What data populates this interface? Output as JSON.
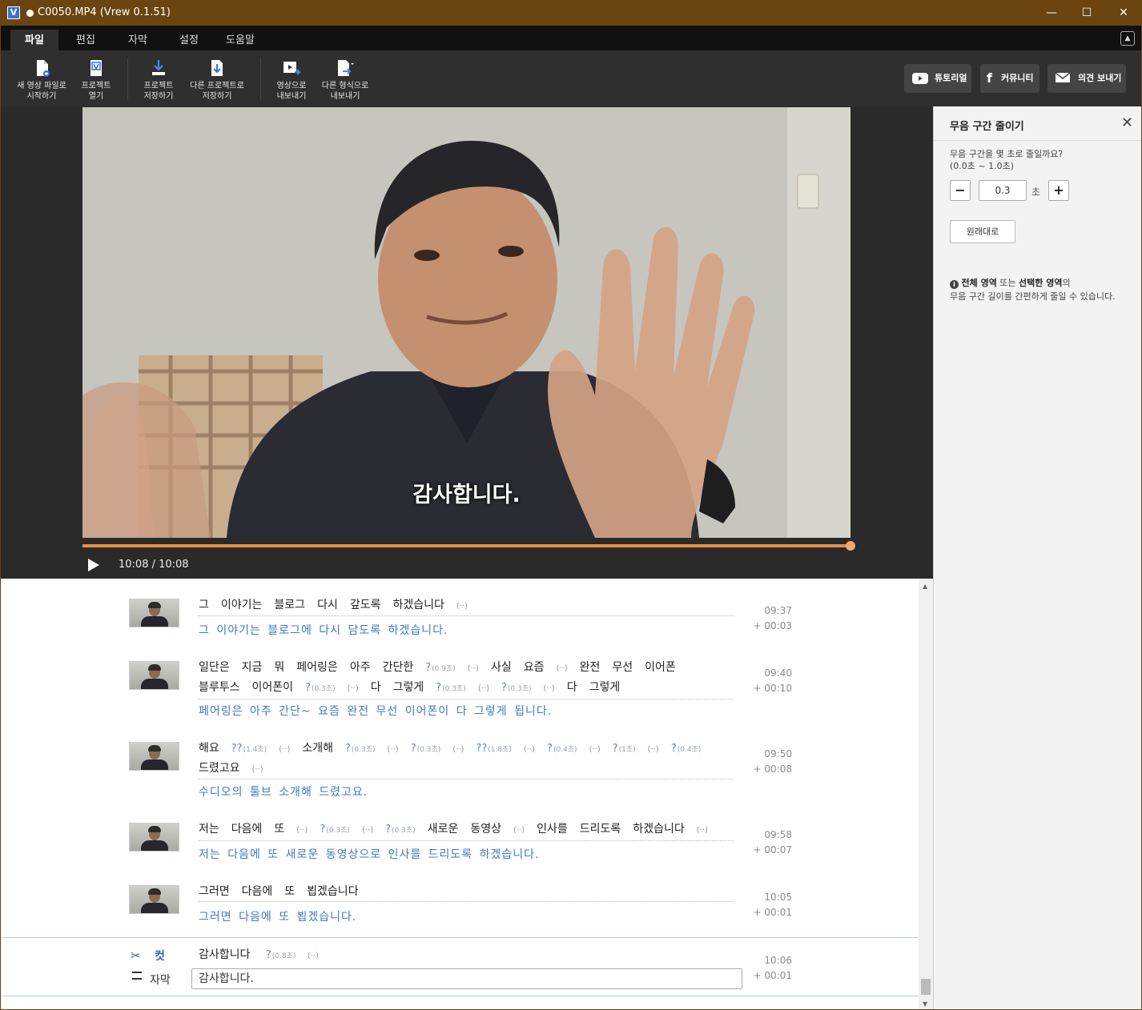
{
  "window": {
    "logo": "V",
    "title": "C0050.MP4 (Vrew 0.1.51)",
    "minimize": "—",
    "maximize": "☐",
    "close": "✕"
  },
  "menu": {
    "tabs": [
      {
        "label": "파일",
        "active": true
      },
      {
        "label": "편집",
        "active": false
      },
      {
        "label": "자막",
        "active": false
      },
      {
        "label": "설정",
        "active": false
      },
      {
        "label": "도움말",
        "active": false
      }
    ]
  },
  "toolbar": {
    "new_video": [
      "새 영상 파일로",
      "시작하기"
    ],
    "open_project": [
      "프로젝트",
      "열기"
    ],
    "save_project": [
      "프로젝트",
      "저장하기"
    ],
    "save_as": [
      "다른 프로젝트로",
      "저장하기"
    ],
    "export_video": [
      "영상으로",
      "내보내기"
    ],
    "export_other": [
      "다른 형식으로",
      "내보내기"
    ],
    "tutorial": "튜토리얼",
    "community": "커뮤니티",
    "feedback": "의견 보내기"
  },
  "player": {
    "subtitle": "감사합니다.",
    "timecode": "10:08 / 10:08",
    "progress": 1.0
  },
  "panel": {
    "title": "무음 구간 줄이기",
    "question": "무음 구간을 몇 초로 줄일까요?",
    "range": "(0.0초 ~ 1.0초)",
    "value": "0.3",
    "unit": "초",
    "minus": "−",
    "plus": "+",
    "reset": "원래대로",
    "info_icon": "i",
    "info_part1": "전체 영역",
    "info_part2": " 또는 ",
    "info_part3": "선택한 영역",
    "info_part4": "의",
    "info_line2": "무음 구간 길이를 간편하게 줄일 수 있습니다."
  },
  "transcript": {
    "entries": [
      {
        "words": [
          [
            "그"
          ],
          [
            "이야기는"
          ],
          [
            "블로그"
          ],
          [
            "다시"
          ],
          [
            "갚도록"
          ],
          [
            "하겠습니다"
          ],
          [
            "gap",
            "(··)"
          ]
        ],
        "subtitle": "그 이야기는 블로그에 다시 담도록 하겠습니다.",
        "time": "09:37",
        "duration": "+ 00:03"
      },
      {
        "words": [
          [
            "일단은"
          ],
          [
            "지금"
          ],
          [
            "뭐"
          ],
          [
            "페어링은"
          ],
          [
            "아주"
          ],
          [
            "간단한"
          ],
          [
            "q",
            "?",
            "(0.9초)"
          ],
          [
            "gap",
            "(··)"
          ],
          [
            "사실"
          ],
          [
            "요즘"
          ],
          [
            "gap",
            "(··)"
          ],
          [
            "완전"
          ],
          [
            "무선"
          ],
          [
            "이어폰"
          ],
          [
            "블루투스"
          ],
          [
            "이어폰이"
          ],
          [
            "q",
            "?",
            "(0.3초)"
          ],
          [
            "gap",
            "(··)"
          ],
          [
            "다"
          ],
          [
            "그렇게"
          ],
          [
            "q",
            "?",
            "(0.3초)"
          ],
          [
            "gap",
            "(··)"
          ],
          [
            "q",
            "?",
            "(0.3초)"
          ],
          [
            "gap",
            "(··)"
          ],
          [
            "다"
          ],
          [
            "그렇게"
          ]
        ],
        "subtitle": "페어링은 아주 간단~ 요즘 완전 무선 이어폰이 다 그렇게 됩니다.",
        "time": "09:40",
        "duration": "+ 00:10"
      },
      {
        "words": [
          [
            "해요"
          ],
          [
            "q",
            "??",
            "(1.4초)"
          ],
          [
            "gap",
            "(··)"
          ],
          [
            "소개해"
          ],
          [
            "q",
            "?",
            "(0.3초)"
          ],
          [
            "gap",
            "(··)"
          ],
          [
            "q",
            "?",
            "(0.3초)"
          ],
          [
            "gap",
            "(··)"
          ],
          [
            "q",
            "??",
            "(1.8초)"
          ],
          [
            "gap",
            "(··)"
          ],
          [
            "q",
            "?",
            "(0.4초)"
          ],
          [
            "gap",
            "(··)"
          ],
          [
            "q",
            "?",
            "(1초)"
          ],
          [
            "gap",
            "(··)"
          ],
          [
            "q",
            "?",
            "(0.4초)"
          ],
          [
            "드렸고요"
          ],
          [
            "gap",
            "(··)"
          ]
        ],
        "subtitle": "수디오의 툴브 소개해 드렸고요.",
        "time": "09:50",
        "duration": "+ 00:08"
      },
      {
        "words": [
          [
            "저는"
          ],
          [
            "다음에"
          ],
          [
            "또"
          ],
          [
            "gap",
            "(··)"
          ],
          [
            "q",
            "?",
            "(0.3초)"
          ],
          [
            "gap",
            "(··)"
          ],
          [
            "q",
            "?",
            "(0.3초)"
          ],
          [
            "새로운"
          ],
          [
            "동영상"
          ],
          [
            "gap",
            "(··)"
          ],
          [
            "인사를"
          ],
          [
            "드리도록"
          ],
          [
            "하겠습니다"
          ],
          [
            "gap",
            "(··)"
          ]
        ],
        "subtitle": "저는 다음에 또 새로운 동영상으로 인사를 드리도록 하겠습니다.",
        "time": "09:58",
        "duration": "+ 00:07"
      },
      {
        "words": [
          [
            "그러면"
          ],
          [
            "다음에"
          ],
          [
            "또"
          ],
          [
            "뵙겠습니다"
          ]
        ],
        "subtitle": "그러면 다음에 또 뵙겠습니다.",
        "time": "10:05",
        "duration": "+ 00:01"
      }
    ],
    "selected": {
      "cut_label": "컷",
      "sub_label": "자막",
      "word": "감사합니다",
      "q": "?",
      "q_len": "(0.8초)",
      "gap": "(··)",
      "input_value": "감사합니다.",
      "time": "10:06",
      "duration": "+ 00:01"
    }
  },
  "colors": {
    "titlebar": "#6b4410",
    "accent_progress": "#e88f45",
    "subtitle_blue": "#3f7bbf",
    "question_blue": "#5b86c4"
  }
}
